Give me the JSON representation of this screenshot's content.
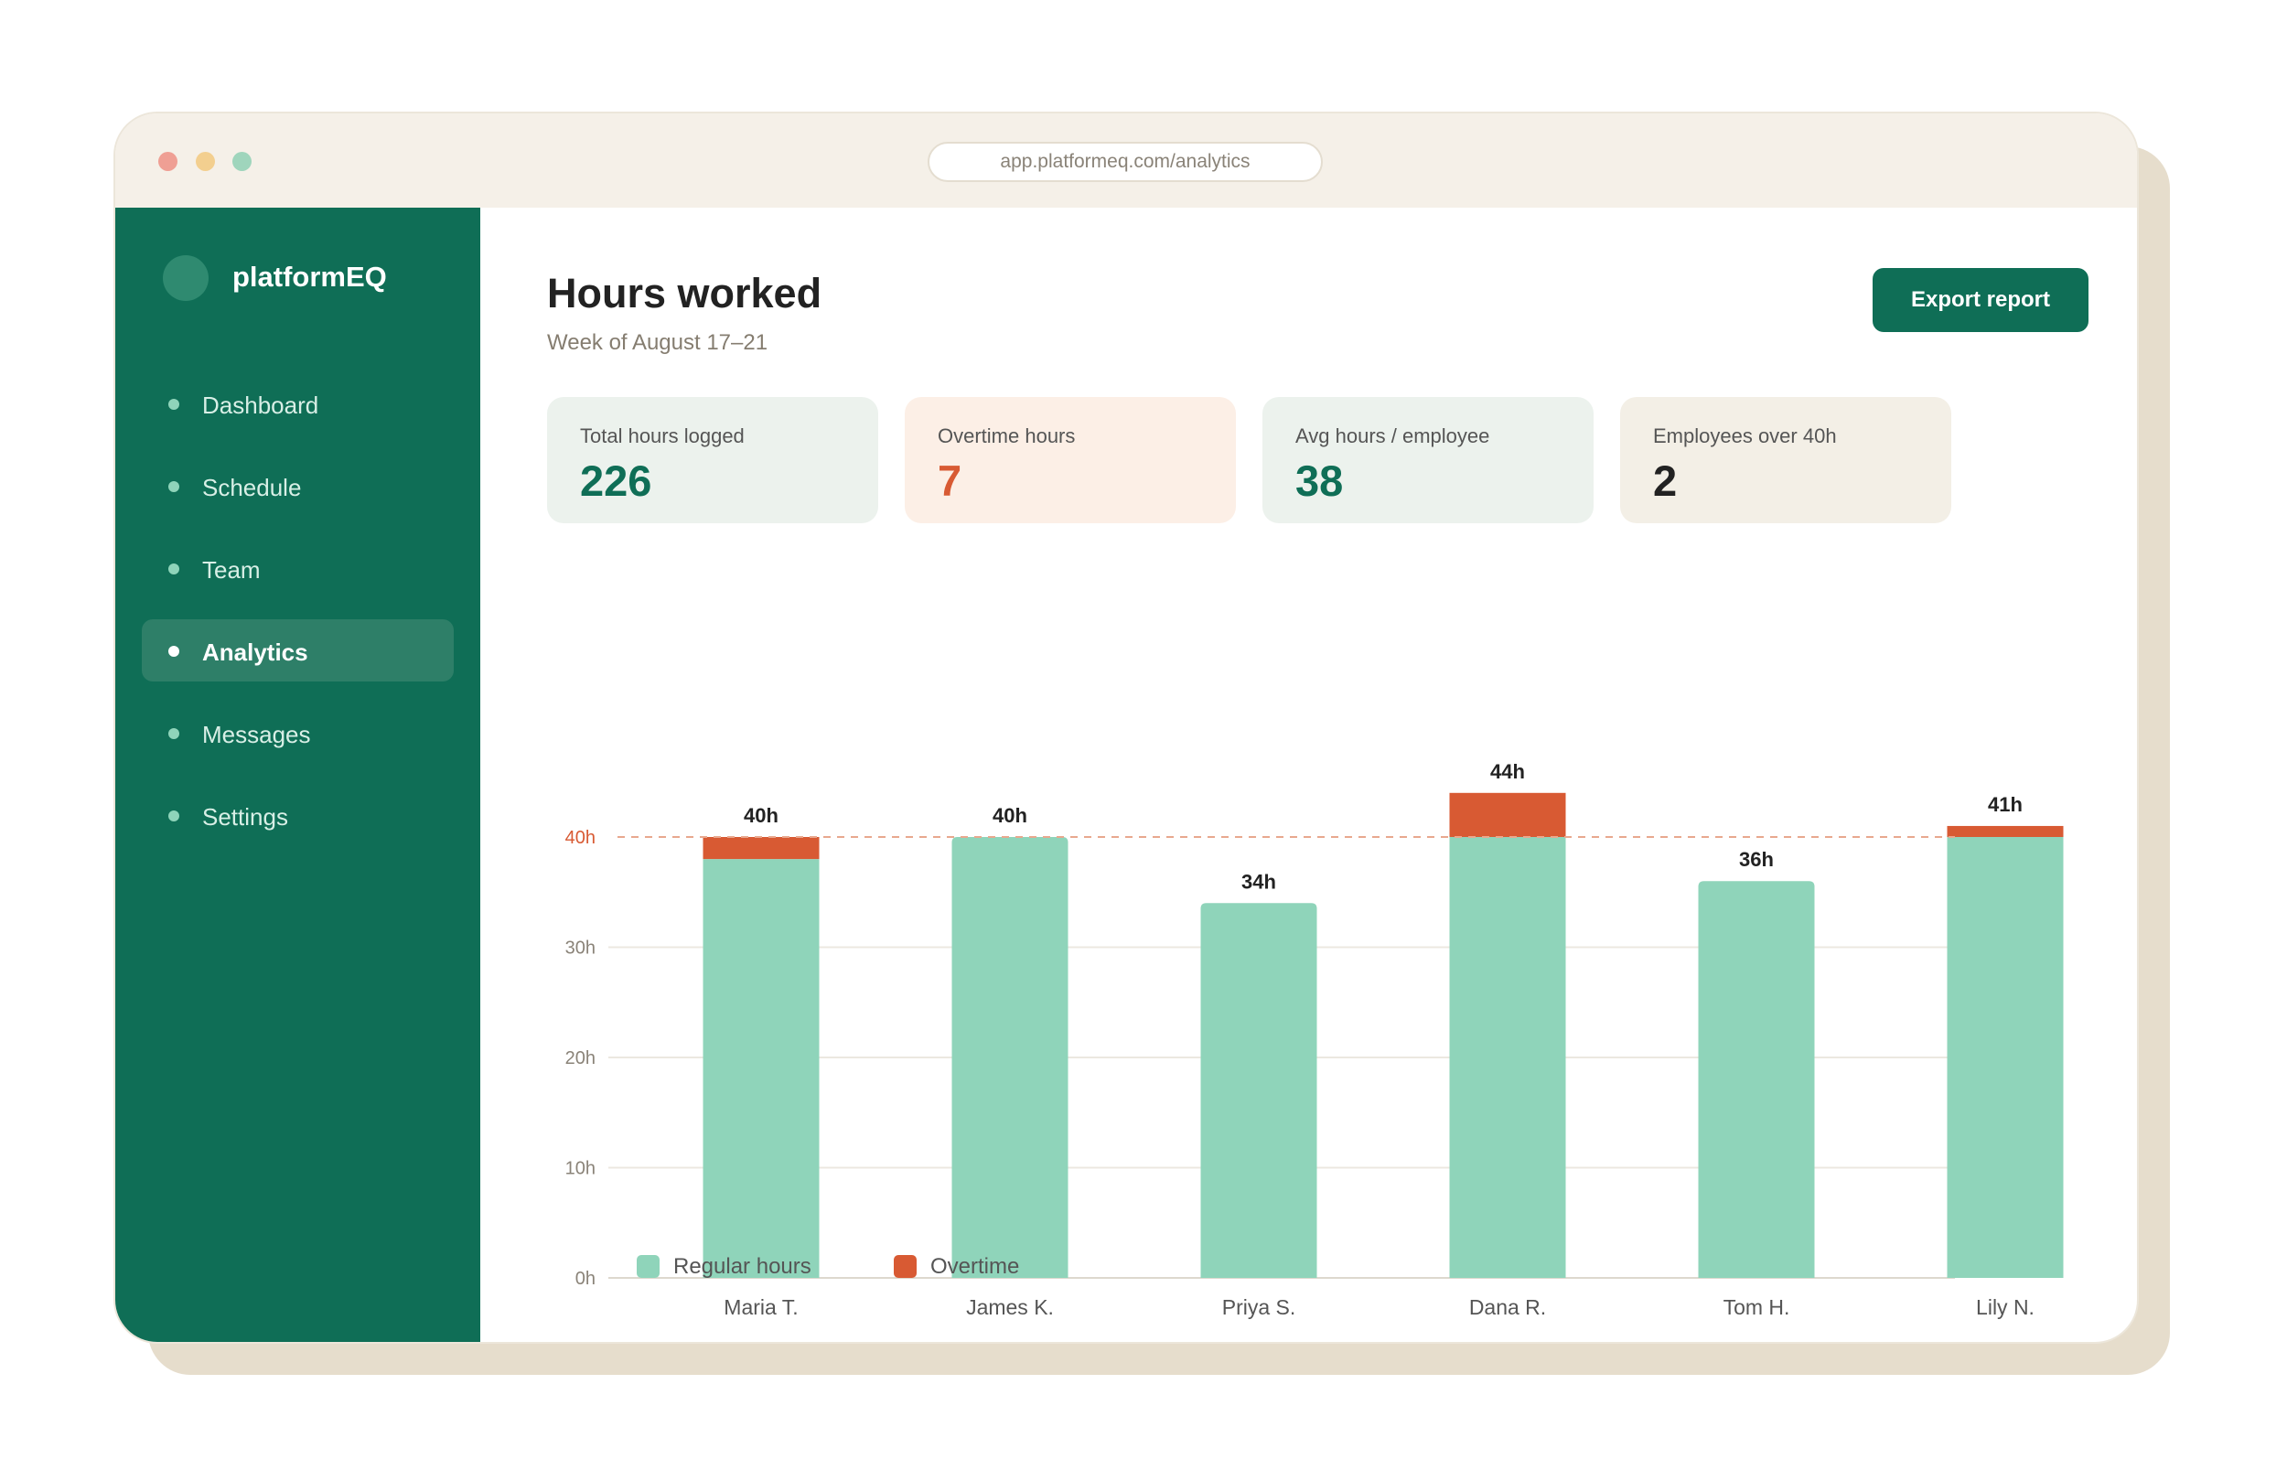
{
  "browser": {
    "url": "app.platformeq.com/analytics"
  },
  "brand": {
    "name": "platformEQ"
  },
  "nav": {
    "items": [
      {
        "label": "Dashboard",
        "active": false
      },
      {
        "label": "Schedule",
        "active": false
      },
      {
        "label": "Team",
        "active": false
      },
      {
        "label": "Analytics",
        "active": true
      },
      {
        "label": "Messages",
        "active": false
      },
      {
        "label": "Settings",
        "active": false
      }
    ]
  },
  "header": {
    "title": "Hours worked",
    "subtitle": "Week of August 17–21",
    "export_label": "Export report"
  },
  "stats": [
    {
      "label": "Total hours logged",
      "value": "226",
      "bg": "#ecf2ed",
      "color": "#0f6e56"
    },
    {
      "label": "Overtime hours",
      "value": "7",
      "bg": "#fcefe6",
      "color": "#d85a33"
    },
    {
      "label": "Avg hours / employee",
      "value": "38",
      "bg": "#ecf2ed",
      "color": "#0f6e56"
    },
    {
      "label": "Employees over 40h",
      "value": "2",
      "bg": "#f3efe6",
      "color": "#222222"
    }
  ],
  "colors": {
    "brand": "#0f6e56",
    "regular": "#8fd4ba",
    "overtime": "#d85a33",
    "threshold": "#e8a88e",
    "grid": "#ece8e0"
  },
  "chart_data": {
    "type": "bar",
    "stacked": true,
    "categories": [
      "Maria T.",
      "James K.",
      "Priya S.",
      "Dana R.",
      "Tom H.",
      "Lily N."
    ],
    "series": [
      {
        "name": "Regular hours",
        "values": [
          38,
          40,
          34,
          40,
          36,
          40
        ]
      },
      {
        "name": "Overtime",
        "values": [
          2,
          0,
          0,
          4,
          0,
          1
        ]
      }
    ],
    "data_labels": [
      "40h",
      "40h",
      "34h",
      "44h",
      "36h",
      "41h"
    ],
    "y_ticks": [
      "0h",
      "10h",
      "20h",
      "30h",
      "40h"
    ],
    "ylim": [
      0,
      40
    ],
    "threshold": {
      "value": 40,
      "label": "40h"
    },
    "grid": true,
    "legend": "bottom-left"
  }
}
